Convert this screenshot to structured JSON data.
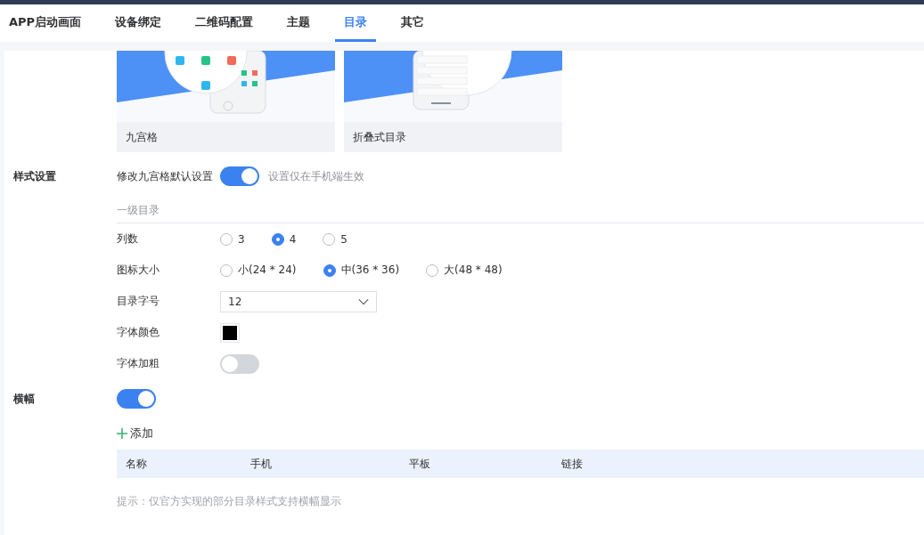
{
  "tabs": [
    {
      "label": "APP启动画面",
      "selected": false
    },
    {
      "label": "设备绑定",
      "selected": false
    },
    {
      "label": "二维码配置",
      "selected": false
    },
    {
      "label": "主题",
      "selected": false
    },
    {
      "label": "目录",
      "selected": true
    },
    {
      "label": "其它",
      "selected": false
    }
  ],
  "templates": [
    {
      "label": "九宫格",
      "kind": "grid"
    },
    {
      "label": "折叠式目录",
      "kind": "fold"
    }
  ],
  "style_settings": {
    "label": "样式设置",
    "toggle_label": "修改九宫格默认设置",
    "on": true,
    "hint": "设置仅在手机端生效",
    "section_title": "一级目录",
    "rows": [
      {
        "kind": "radio",
        "label": "列数",
        "options": [
          {
            "label": "3",
            "selected": false
          },
          {
            "label": "4",
            "selected": true
          },
          {
            "label": "5",
            "selected": false
          }
        ]
      },
      {
        "kind": "radio",
        "label": "图标大小",
        "options": [
          {
            "label": "小(24 * 24)",
            "selected": false
          },
          {
            "label": "中(36 * 36)",
            "selected": true
          },
          {
            "label": "大(48 * 48)",
            "selected": false
          }
        ]
      },
      {
        "kind": "select",
        "label": "目录字号",
        "value": "12"
      },
      {
        "kind": "color",
        "label": "字体颜色",
        "color": "#000000"
      },
      {
        "kind": "switch",
        "label": "字体加粗",
        "on": false
      }
    ]
  },
  "banner": {
    "label": "横幅",
    "on": true,
    "add_label": "添加",
    "table": {
      "columns": [
        "名称",
        "手机",
        "平板",
        "链接"
      ]
    },
    "tip": "提示：仅官方实现的部分目录样式支持横幅显示"
  }
}
